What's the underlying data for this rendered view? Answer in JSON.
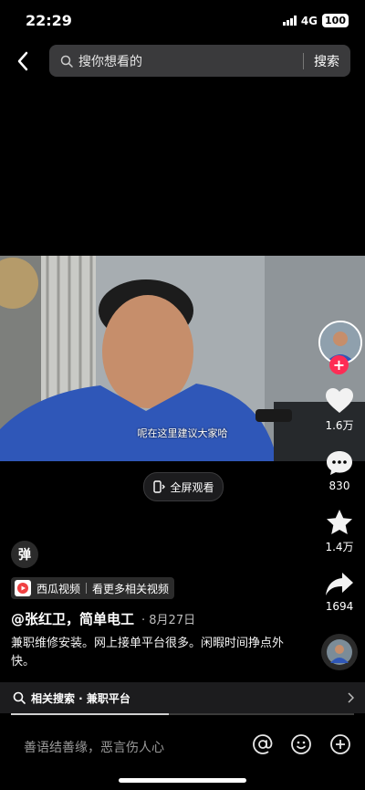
{
  "status_bar": {
    "time": "22:29",
    "network": "4G",
    "battery": "100"
  },
  "search": {
    "placeholder": "搜你想看的",
    "button_label": "搜索"
  },
  "video": {
    "subtitle": "呢在这里建议大家哈",
    "fullscreen_label": "全屏观看",
    "progress_fraction": 0.46
  },
  "actions": {
    "likes": "1.6万",
    "comments": "830",
    "favorites": "1.4万",
    "shares": "1694"
  },
  "info": {
    "danmu_label": "弹",
    "source_name": "西瓜视频",
    "source_more": "看更多相关视频",
    "author": "@张红卫，简单电工",
    "date": "· 8月27日",
    "description": "兼职维修安装。网上接单平台很多。闲暇时间挣点外快。"
  },
  "related": {
    "label": "相关搜索 · 兼职平台"
  },
  "comment": {
    "placeholder": "善语结善缘，恶言伤人心"
  },
  "colors": {
    "accent": "#fe2c55",
    "background": "#000000"
  },
  "icons": [
    "back-icon",
    "search-icon",
    "fullscreen-icon",
    "heart-icon",
    "comment-icon",
    "star-icon",
    "share-icon",
    "at-icon",
    "emoji-icon",
    "plus-icon",
    "chevron-right-icon"
  ]
}
